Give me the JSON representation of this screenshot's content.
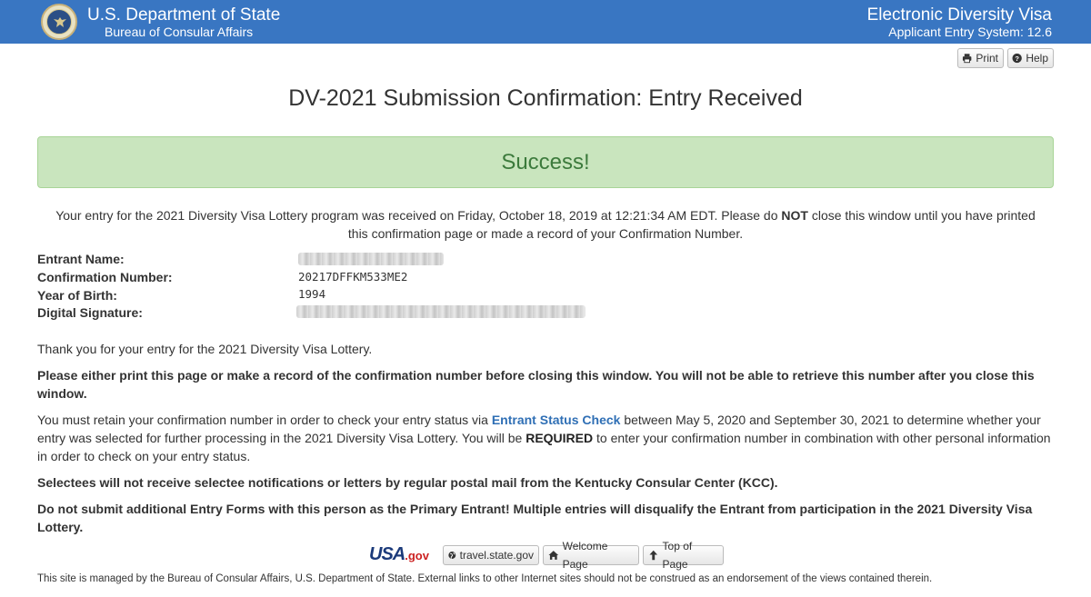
{
  "header": {
    "department": "U.S. Department of State",
    "bureau": "Bureau of Consular Affairs",
    "program": "Electronic Diversity Visa",
    "system": "Applicant Entry System: 12.6"
  },
  "toolbar": {
    "print_label": "Print",
    "help_label": "Help"
  },
  "page_title": "DV-2021 Submission Confirmation: Entry Received",
  "success_text": "Success!",
  "received": {
    "text_before": "Your entry for the 2021 Diversity Visa Lottery program was received on Friday, October 18, 2019 at 12:21:34 AM EDT. Please do ",
    "text_bold": "NOT",
    "text_after": " close this window until you have printed this confirmation page or made a record of your Confirmation Number."
  },
  "entry_info": {
    "name_label": "Entrant Name:",
    "confirmation_label": "Confirmation Number:",
    "confirmation_value": "20217DFFKM533ME2",
    "birth_label": "Year of Birth:",
    "birth_value": "1994",
    "signature_label": "Digital Signature:"
  },
  "paragraphs": {
    "thank_you": "Thank you for your entry for the 2021 Diversity Visa Lottery.",
    "print_warning": "Please either print this page or make a record of the confirmation number before closing this window. You will not be able to retrieve this number after you close this window.",
    "retain_1": "You must retain your confirmation number in order to check your entry status via ",
    "status_link": "Entrant Status Check",
    "retain_2": " between May 5, 2020 and September 30, 2021 to determine whether your entry was selected for further processing in the 2021 Diversity Visa Lottery. You will be ",
    "retain_required": "REQUIRED",
    "retain_3": " to enter your confirmation number in combination with other personal information in order to check on your entry status.",
    "selectees": "Selectees will not receive selectee notifications or letters by regular postal mail from the Kentucky Consular Center (KCC).",
    "no_additional": "Do not submit additional Entry Forms with this person as the Primary Entrant! Multiple entries will disqualify the Entrant from participation in the 2021 Diversity Visa Lottery."
  },
  "footer": {
    "usagov_logo_text": "USA",
    "usagov_logo_suffix": ".gov",
    "travel_label": "travel.state.gov",
    "welcome_label": "Welcome Page",
    "top_label": "Top of Page",
    "disclaimer": "This site is managed by the Bureau of Consular Affairs, U.S. Department of State. External links to other Internet sites should not be construed as an endorsement of the views contained therein."
  }
}
